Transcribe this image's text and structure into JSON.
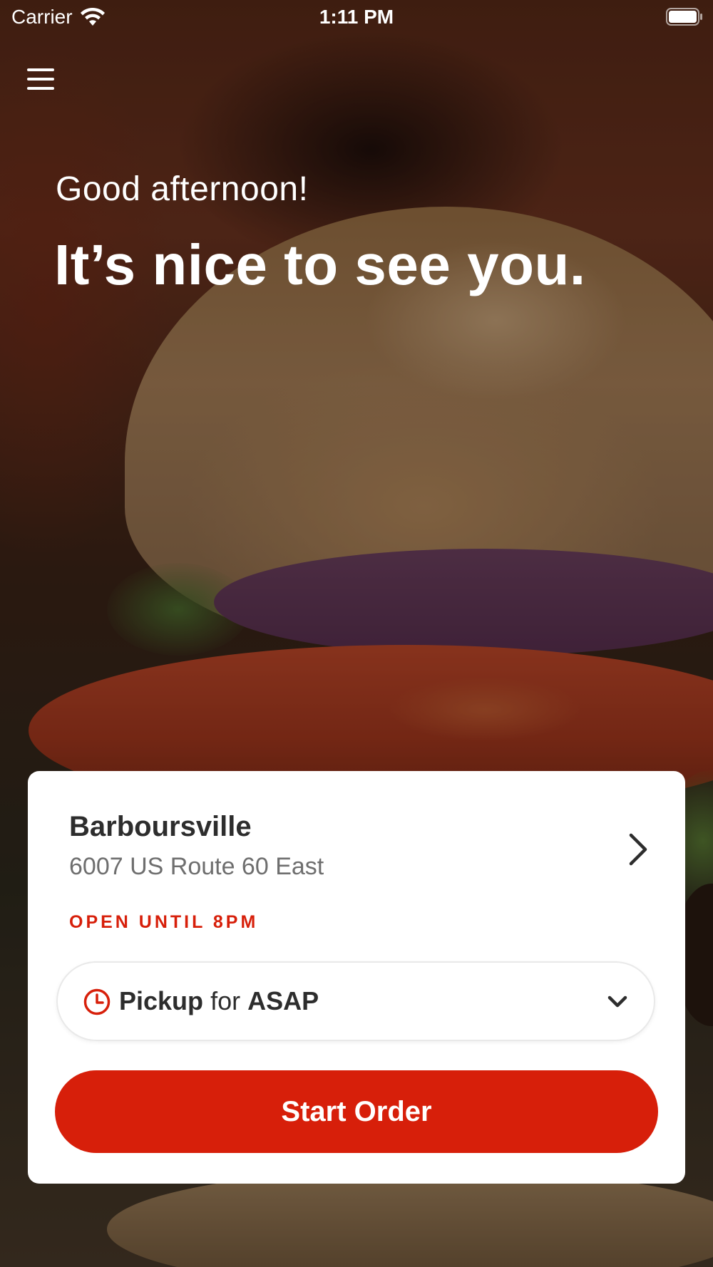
{
  "status_bar": {
    "carrier": "Carrier",
    "time": "1:11 PM",
    "icons": [
      "wifi-icon",
      "battery-icon"
    ]
  },
  "header": {
    "menu_icon": "hamburger-menu-icon",
    "greeting": "Good afternoon!",
    "headline": "It’s nice to see you."
  },
  "location": {
    "name": "Barboursville",
    "address": "6007 US Route 60 East",
    "hours_status": "OPEN UNTIL 8PM"
  },
  "order_type": {
    "icon": "clock-icon",
    "mode": "Pickup",
    "connector": "for",
    "time": "ASAP"
  },
  "cta": {
    "label": "Start Order"
  },
  "colors": {
    "accent": "#d71f0a",
    "text_primary": "#2d2d2d",
    "text_secondary": "#6e6e6e",
    "card_background": "#ffffff"
  }
}
